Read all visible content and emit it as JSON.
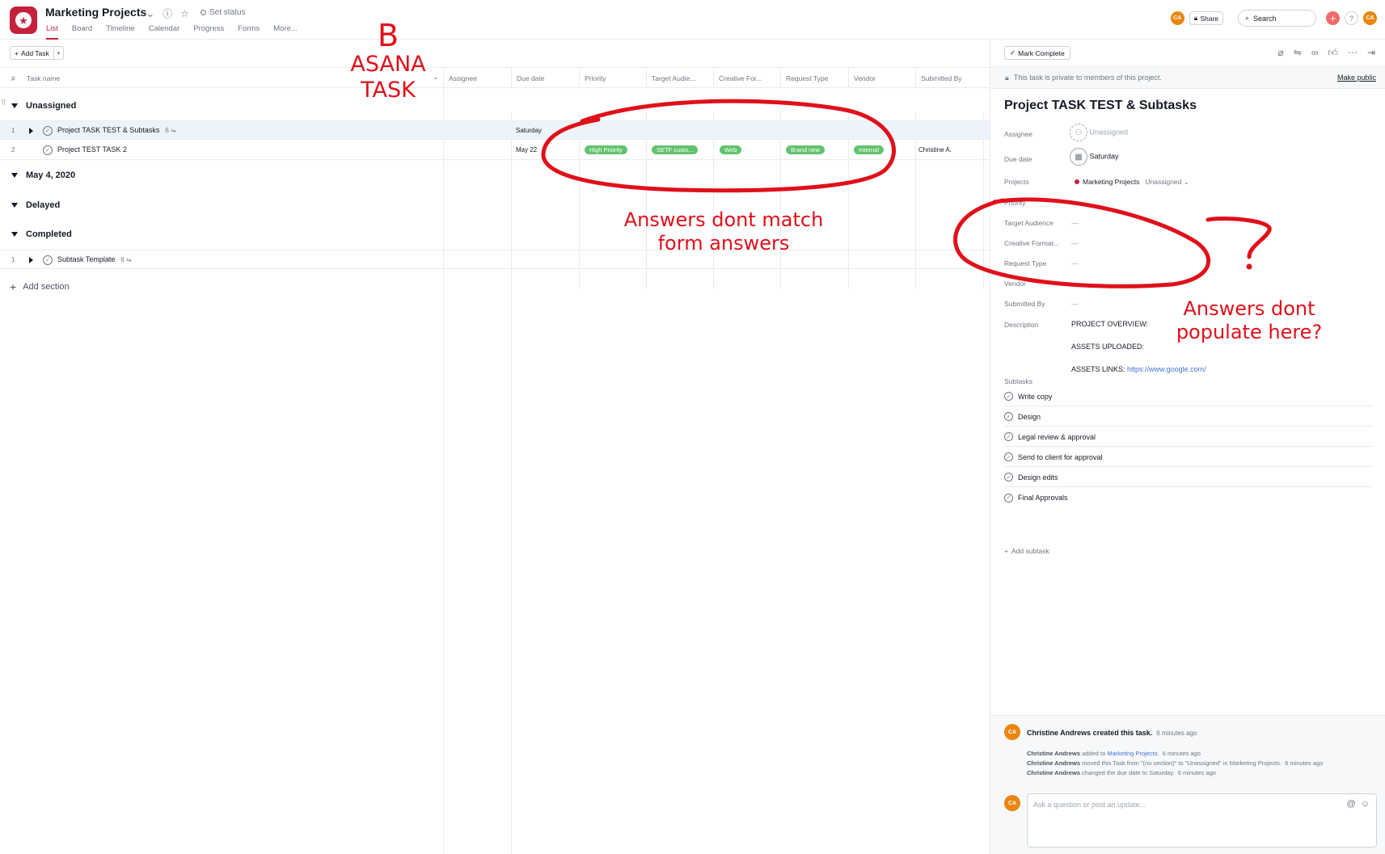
{
  "header": {
    "project_title": "Marketing Projects",
    "set_status": "Set status",
    "tabs": [
      "List",
      "Board",
      "Timeline",
      "Calendar",
      "Progress",
      "Forms",
      "More..."
    ],
    "active_tab": "List",
    "avatar_initials": "CA",
    "share_label": "Share",
    "search_placeholder": "Search",
    "help_label": "?"
  },
  "list": {
    "add_task_label": "Add Task",
    "columns": [
      "#",
      "Task name",
      "Assignee",
      "Due date",
      "Priority",
      "Target Audie...",
      "Creative For...",
      "Request Type",
      "Vendor",
      "Submitted By"
    ],
    "sections": [
      {
        "name": "Unassigned",
        "tasks": [
          {
            "num": "1",
            "name": "Project TASK TEST & Subtasks",
            "subtasks": "6",
            "due": "Saturday",
            "selected": true
          },
          {
            "num": "2",
            "name": "Project TEST TASK 2",
            "due": "May 22",
            "priority": "High Priority",
            "target_audience": "SETF custo...",
            "creative_format": "Web",
            "request_type": "Brand new",
            "vendor": "Internal",
            "submitted_by": "Christine A."
          }
        ]
      },
      {
        "name": "May 4, 2020",
        "tasks": []
      },
      {
        "name": "Delayed",
        "tasks": []
      },
      {
        "name": "Completed",
        "tasks": [
          {
            "num": "1",
            "name": "Subtask Template",
            "subtasks": "6"
          }
        ]
      }
    ],
    "add_section_label": "Add section"
  },
  "detail": {
    "mark_complete_label": "Mark Complete",
    "private_notice": "This task is private to members of this project.",
    "make_public_label": "Make public",
    "title": "Project TASK TEST & Subtasks",
    "fields": {
      "assignee_label": "Assignee",
      "assignee_value": "Unassigned",
      "due_label": "Due date",
      "due_value": "Saturday",
      "projects_label": "Projects",
      "project_name": "Marketing Projects",
      "project_section": "Unassigned",
      "priority_label": "Priority",
      "target_audience_label": "Target Audience",
      "creative_format_label": "Creative Format...",
      "request_type_label": "Request Type",
      "vendor_label": "Vendor",
      "submitted_by_label": "Submitted By",
      "description_label": "Description",
      "empty_value": "—"
    },
    "description": {
      "overview": "PROJECT OVERVIEW:",
      "assets_uploaded": "ASSETS UPLOADED:",
      "assets_links_label": "ASSETS LINKS:",
      "assets_links_url": "https://www.google.com/"
    },
    "subtasks_label": "Subtasks",
    "subtasks": [
      "Write copy",
      "Design",
      "Legal review & approval",
      "Send to client for approval",
      "Design edits",
      "Final Approvals"
    ],
    "add_subtask_label": "Add subtask",
    "activity": {
      "main": "Christine Andrews created this task.",
      "main_time": "6 minutes ago",
      "lines": [
        {
          "who": "Christine Andrews",
          "text": "added to",
          "link": "Marketing Projects.",
          "time": "6 minutes ago"
        },
        {
          "who": "Christine Andrews",
          "text": "moved this Task from \"(no section)\" to \"Unassigned\" in Marketing Projects.",
          "link": "",
          "time": "6 minutes ago"
        },
        {
          "who": "Christine Andrews",
          "text": "changed the due date to Saturday.",
          "link": "",
          "time": "6 minutes ago"
        }
      ],
      "comment_placeholder": "Ask a question or post an update..."
    }
  },
  "annotations": {
    "label_b": "B",
    "label_asana": "ASANA",
    "label_task": "TASK",
    "note_1_line1": "Answers dont match",
    "note_1_line2": "form answers",
    "note_2_line1": "Answers dont",
    "note_2_line2": "populate here?",
    "color": "#e0101a"
  },
  "colors": {
    "brand": "#c4213c",
    "pill_green": "#62c36e",
    "avatar_orange": "#e8860f",
    "link_blue": "#4573d2"
  }
}
